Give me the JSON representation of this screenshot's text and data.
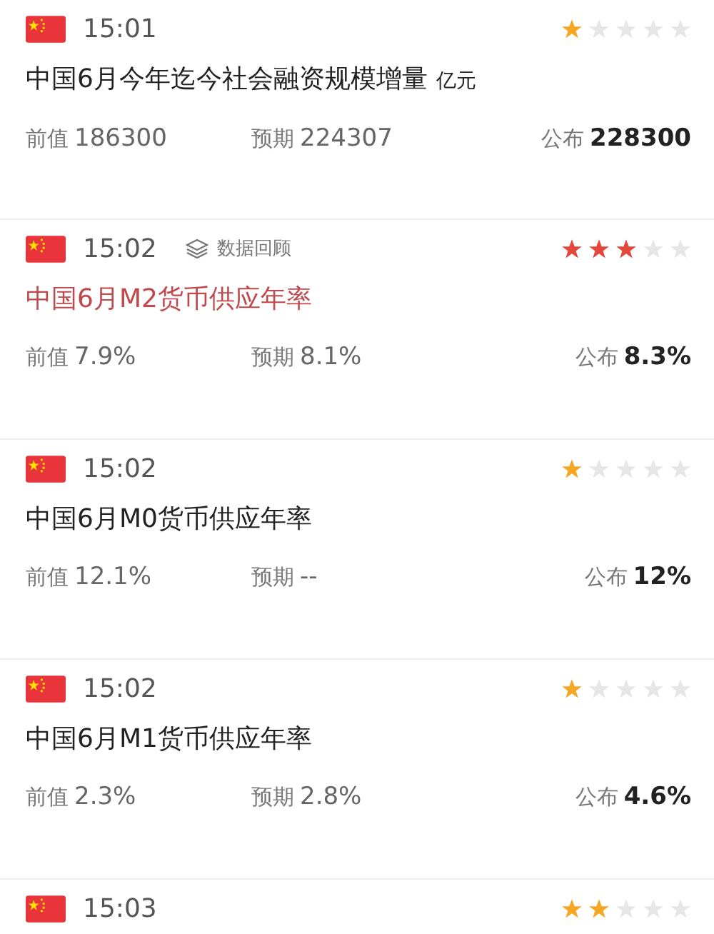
{
  "events": [
    {
      "time": "15:01",
      "stars": 1,
      "important": false,
      "title": "中国6月今年迄今社会融资规模增量",
      "unit": "亿元",
      "previous_label": "前值",
      "previous": "186300",
      "forecast_label": "预期",
      "forecast": "224307",
      "actual_label": "公布",
      "actual": "228300"
    },
    {
      "time": "15:02",
      "review": "数据回顾",
      "stars": 3,
      "important": true,
      "title": "中国6月M2货币供应年率",
      "previous_label": "前值",
      "previous": "7.9%",
      "forecast_label": "预期",
      "forecast": "8.1%",
      "actual_label": "公布",
      "actual": "8.3%"
    },
    {
      "time": "15:02",
      "stars": 1,
      "important": false,
      "title": "中国6月M0货币供应年率",
      "previous_label": "前值",
      "previous": "12.1%",
      "forecast_label": "预期",
      "forecast": "--",
      "actual_label": "公布",
      "actual": "12%"
    },
    {
      "time": "15:02",
      "stars": 1,
      "important": false,
      "title": "中国6月M1货币供应年率",
      "previous_label": "前值",
      "previous": "2.3%",
      "forecast_label": "预期",
      "forecast": "2.8%",
      "actual_label": "公布",
      "actual": "4.6%"
    },
    {
      "time": "15:03",
      "stars": 2
    }
  ]
}
